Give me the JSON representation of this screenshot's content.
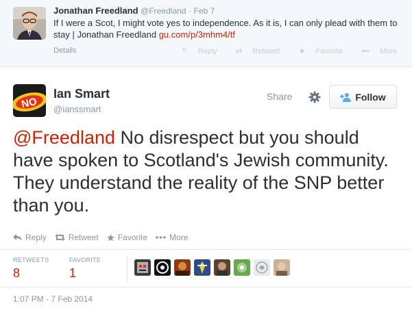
{
  "parent_tweet": {
    "name": "Jonathan Freedland",
    "handle": "@Freedland",
    "dot": "·",
    "date": "Feb 7",
    "text_before_link": "If I were a Scot, I might vote yes to independence. As it is, I can only plead with them to stay | Jonathan Freedland ",
    "link": "gu.com/p/3mhm4/tf",
    "details_label": "Details",
    "actions": {
      "reply": "Reply",
      "retweet": "Retweet",
      "favorite": "Favorite",
      "more": "More"
    }
  },
  "main_tweet": {
    "name": "Ian Smart",
    "handle": "@ianssmart",
    "share_label": "Share",
    "follow_label": "Follow",
    "avatar_text": "NO",
    "mention": "@Freedland",
    "text": " No disrespect but you should have spoken to Scotland's Jewish community. They understand the reality of the SNP better than you.",
    "actions": {
      "reply": "Reply",
      "retweet": "Retweet",
      "favorite": "Favorite",
      "more": "More"
    },
    "stats": {
      "retweets_label": "RETWEETS",
      "retweets_value": "8",
      "favorites_label": "FAVORITE",
      "favorites_value": "1"
    },
    "timestamp": "1:07 PM - 7 Feb 2014"
  },
  "colors": {
    "link": "#cc2200",
    "muted": "#8899a6",
    "text": "#292f33",
    "border": "#e1e8ed"
  }
}
